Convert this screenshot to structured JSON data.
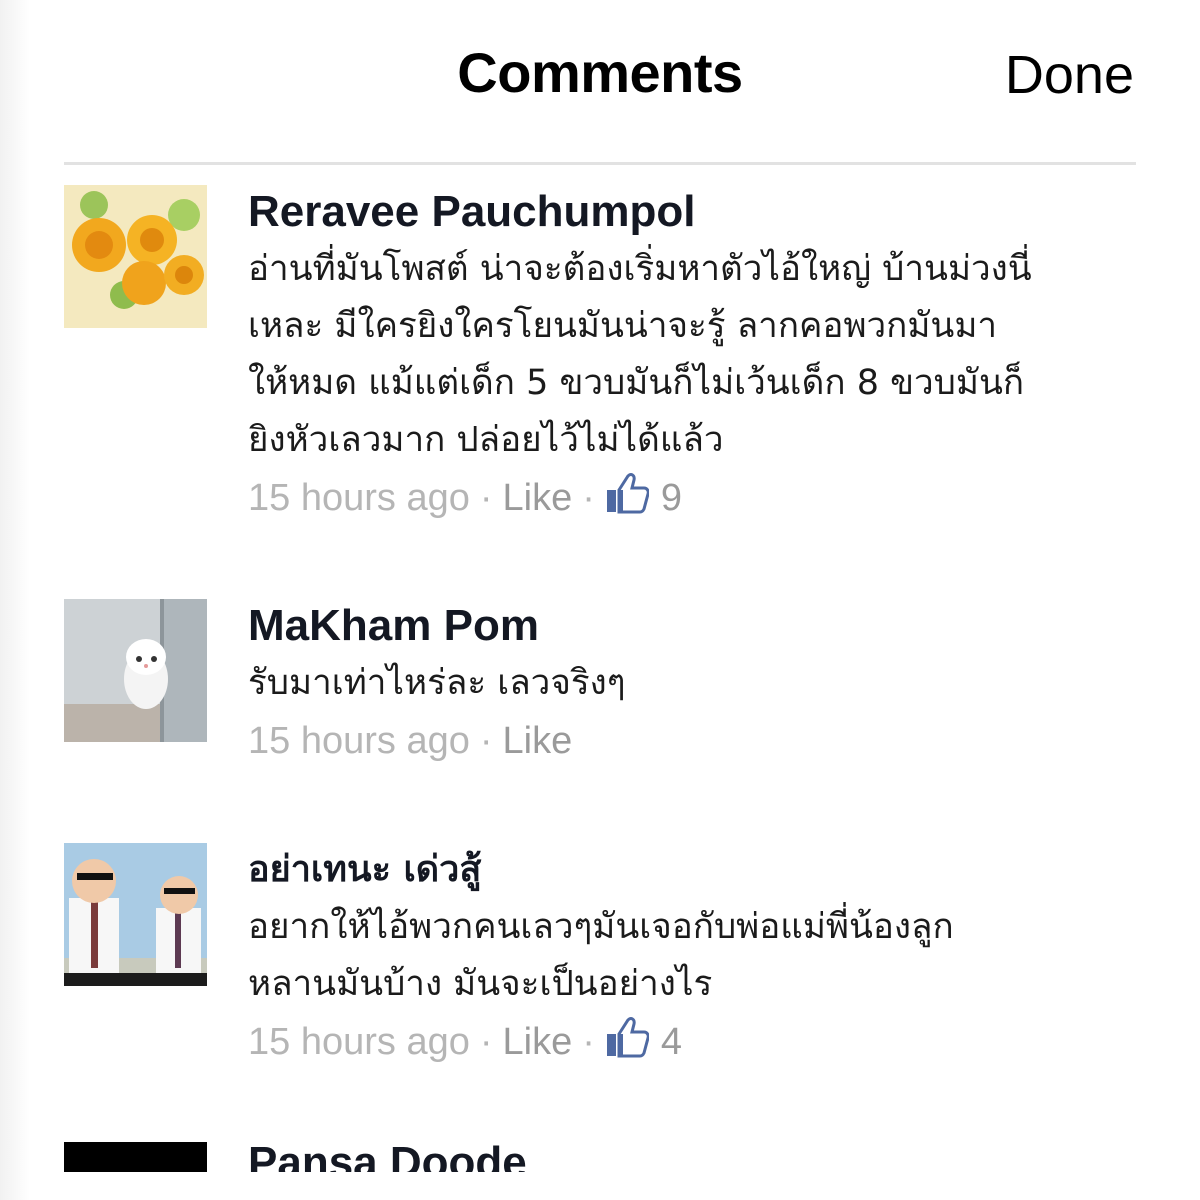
{
  "header": {
    "title": "Comments",
    "done_label": "Done"
  },
  "comments": [
    {
      "author": "Reravee Pauchumpol",
      "lines": [
        "อ่านที่มันโพสต์ น่าจะต้องเริ่มหาตัวไอ้ใหญ่ บ้านม่วงนี่",
        "เหละ มีใครยิงใครโยนมันน่าจะรู้ ลากคอพวกมันมา",
        "ให้หมด แม้แต่เด็ก 5 ขวบมันก็ไม่เว้นเด็ก 8 ขวบมันก็",
        "ยิงหัวเลวมาก ปล่อยไว้ไม่ได้แล้ว"
      ],
      "time": "15 hours ago",
      "like_label": "Like",
      "like_count": "9"
    },
    {
      "author": "MaKham Pom",
      "lines": [
        "รับมาเท่าไหร่ละ เลวจริงๆ"
      ],
      "time": "15 hours ago",
      "like_label": "Like"
    },
    {
      "author": "อย่าเทนะ เด่วสู้",
      "lines": [
        "อยากให้ไอ้พวกคนเลวๆมันเจอกับพ่อแม่พี่น้องลูก",
        "หลานมันบ้าง มันจะเป็นอย่างไร"
      ],
      "time": "15 hours ago",
      "like_label": "Like",
      "like_count": "4"
    },
    {
      "author": "Pansa Doode"
    }
  ],
  "icons": {
    "like_thumb": "thumbs-up-icon"
  },
  "colors": {
    "like_icon": "#4e69a2",
    "meta_text": "#b5b5b5"
  }
}
